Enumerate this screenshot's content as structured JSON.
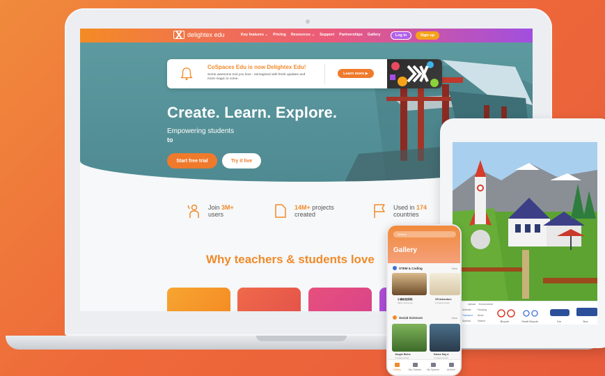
{
  "nav": {
    "logo": "delightex edu",
    "links": [
      "Key features ⌄",
      "Pricing",
      "Resources ⌄",
      "Support",
      "Partnerships",
      "Gallery"
    ],
    "login": "Log in",
    "signup": "Sign up"
  },
  "banner": {
    "title": "CoSpaces Edu is now Delightex Edu!",
    "text": "Some awesome tool you love - reimagined with fresh updates and more magic to come.",
    "button": "Learn more ▶"
  },
  "hero": {
    "title": "Create. Learn. Explore.",
    "subtitle": "Empowering students",
    "subtitle2": "to",
    "trial_button": "Start free trial",
    "live_button": "Try it live"
  },
  "stats": [
    {
      "prefix": "Join ",
      "highlight": "3M+",
      "suffix": " users"
    },
    {
      "prefix": "",
      "highlight": "14M+",
      "suffix": " projects created"
    },
    {
      "prefix": "Used in ",
      "highlight": "174",
      "suffix": " countries"
    }
  ],
  "why_title": "Why teachers & students love",
  "tablet": {
    "tools": [
      "Upload",
      "Environment"
    ],
    "categories": [
      "Animals",
      "Housing",
      "Transport",
      "Items",
      "Special",
      "Search"
    ],
    "items": [
      "Bicycle",
      "Small Bicycle",
      "Car",
      "Bus"
    ]
  },
  "phone": {
    "search": "Search",
    "title": "Gallery",
    "sections": [
      {
        "name": "STEM & Coding",
        "view": "View"
      },
      {
        "name": "Social Sciences",
        "view": "View"
      }
    ],
    "thumbs": [
      {
        "title": "小蝌蚪找妈妈",
        "sub": "MEPL Ecospace"
      },
      {
        "title": "VR Adventure",
        "sub": "CoSpacesTeam"
      },
      {
        "title": "Jungle Ruins",
        "sub": "CoSpacesTeam"
      },
      {
        "title": "Dance Day a",
        "sub": "CoSpacesTeam"
      }
    ],
    "tabs": [
      "Gallery",
      "My Classes",
      "My Spaces",
      "Archive"
    ]
  },
  "colors": {
    "accent": "#f08a2a",
    "hero_bg": "#5d9aa0",
    "nav_start": "#f48b24",
    "nav_end": "#a14fe0"
  }
}
